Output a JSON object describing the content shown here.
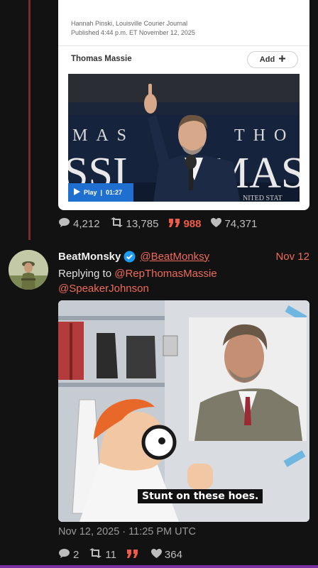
{
  "embed_card": {
    "byline": "Hannah Pinski, Louisville Courier Journal",
    "published": "Published 4:44 p.m. ET November 12, 2025",
    "topic_name": "Thomas Massie",
    "add_label": "Add",
    "video": {
      "play_label": "Play",
      "duration": "01:27",
      "backdrop_text_left": "MAS",
      "backdrop_text_right": "THO",
      "backdrop_big_left": "SSI",
      "backdrop_big_right": "MAS",
      "backdrop_small": "NITED STAT"
    }
  },
  "parent_stats": {
    "replies": "4,212",
    "retweets": "13,785",
    "quotes": "988",
    "likes": "74,371"
  },
  "tweet": {
    "display_name": "BeatMonsky",
    "handle": "@BeatMonksy",
    "date": "Nov 12",
    "replying_to_label": "Replying to",
    "mention_1": "@RepThomasMassie",
    "mention_2": "@SpeakerJohnson",
    "meme_caption": "Stunt on these hoes.",
    "timestamp": "Nov 12, 2025 · 11:25 PM UTC",
    "stats": {
      "replies": "2",
      "retweets": "11",
      "quotes": "",
      "likes": "364"
    }
  },
  "colors": {
    "accent": "#ef6b5a",
    "quote_accent": "#ef5b47",
    "background": "#121212",
    "thread_line": "#7a2b2b",
    "verified": "#1d9bf0"
  }
}
